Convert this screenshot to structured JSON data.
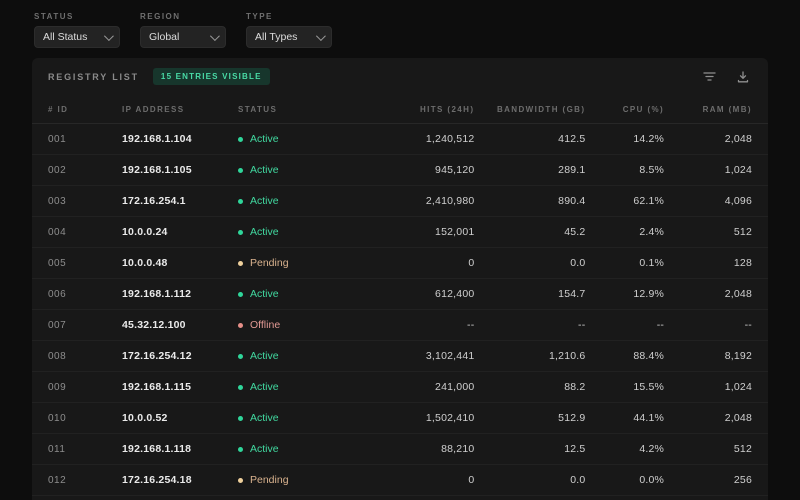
{
  "filters": [
    {
      "label": "Status",
      "value": "All Status"
    },
    {
      "label": "Region",
      "value": "Global"
    },
    {
      "label": "Type",
      "value": "All Types"
    }
  ],
  "registry": {
    "title": "Registry List",
    "badge": "15 Entries Visible",
    "columns": {
      "id": "# ID",
      "ip": "IP Address",
      "status": "Status",
      "hits": "Hits (24h)",
      "bandwidth": "Bandwidth (GB)",
      "cpu": "CPU (%)",
      "ram": "RAM (MB)"
    },
    "rows": [
      {
        "id": "001",
        "ip": "192.168.1.104",
        "status": "Active",
        "hits": "1,240,512",
        "bandwidth": "412.5",
        "cpu": "14.2%",
        "ram": "2,048"
      },
      {
        "id": "002",
        "ip": "192.168.1.105",
        "status": "Active",
        "hits": "945,120",
        "bandwidth": "289.1",
        "cpu": "8.5%",
        "ram": "1,024"
      },
      {
        "id": "003",
        "ip": "172.16.254.1",
        "status": "Active",
        "hits": "2,410,980",
        "bandwidth": "890.4",
        "cpu": "62.1%",
        "ram": "4,096"
      },
      {
        "id": "004",
        "ip": "10.0.0.24",
        "status": "Active",
        "hits": "152,001",
        "bandwidth": "45.2",
        "cpu": "2.4%",
        "ram": "512"
      },
      {
        "id": "005",
        "ip": "10.0.0.48",
        "status": "Pending",
        "hits": "0",
        "bandwidth": "0.0",
        "cpu": "0.1%",
        "ram": "128"
      },
      {
        "id": "006",
        "ip": "192.168.1.112",
        "status": "Active",
        "hits": "612,400",
        "bandwidth": "154.7",
        "cpu": "12.9%",
        "ram": "2,048"
      },
      {
        "id": "007",
        "ip": "45.32.12.100",
        "status": "Offline",
        "hits": "--",
        "bandwidth": "--",
        "cpu": "--",
        "ram": "--"
      },
      {
        "id": "008",
        "ip": "172.16.254.12",
        "status": "Active",
        "hits": "3,102,441",
        "bandwidth": "1,210.6",
        "cpu": "88.4%",
        "ram": "8,192"
      },
      {
        "id": "009",
        "ip": "192.168.1.115",
        "status": "Active",
        "hits": "241,000",
        "bandwidth": "88.2",
        "cpu": "15.5%",
        "ram": "1,024"
      },
      {
        "id": "010",
        "ip": "10.0.0.52",
        "status": "Active",
        "hits": "1,502,410",
        "bandwidth": "512.9",
        "cpu": "44.1%",
        "ram": "2,048"
      },
      {
        "id": "011",
        "ip": "192.168.1.118",
        "status": "Active",
        "hits": "88,210",
        "bandwidth": "12.5",
        "cpu": "4.2%",
        "ram": "512"
      },
      {
        "id": "012",
        "ip": "172.16.254.18",
        "status": "Pending",
        "hits": "0",
        "bandwidth": "0.0",
        "cpu": "0.0%",
        "ram": "256"
      }
    ]
  },
  "icons": {
    "filter": "filter-lines-icon",
    "download": "download-icon",
    "chevron": "chevron-down-icon"
  },
  "colors": {
    "page_bg": "#0d0d0d",
    "card_bg": "#181818",
    "accent_teal": "#49dba6",
    "status_active": "#2fd69a",
    "status_pending": "#efd09c",
    "status_offline": "#e68f88"
  }
}
